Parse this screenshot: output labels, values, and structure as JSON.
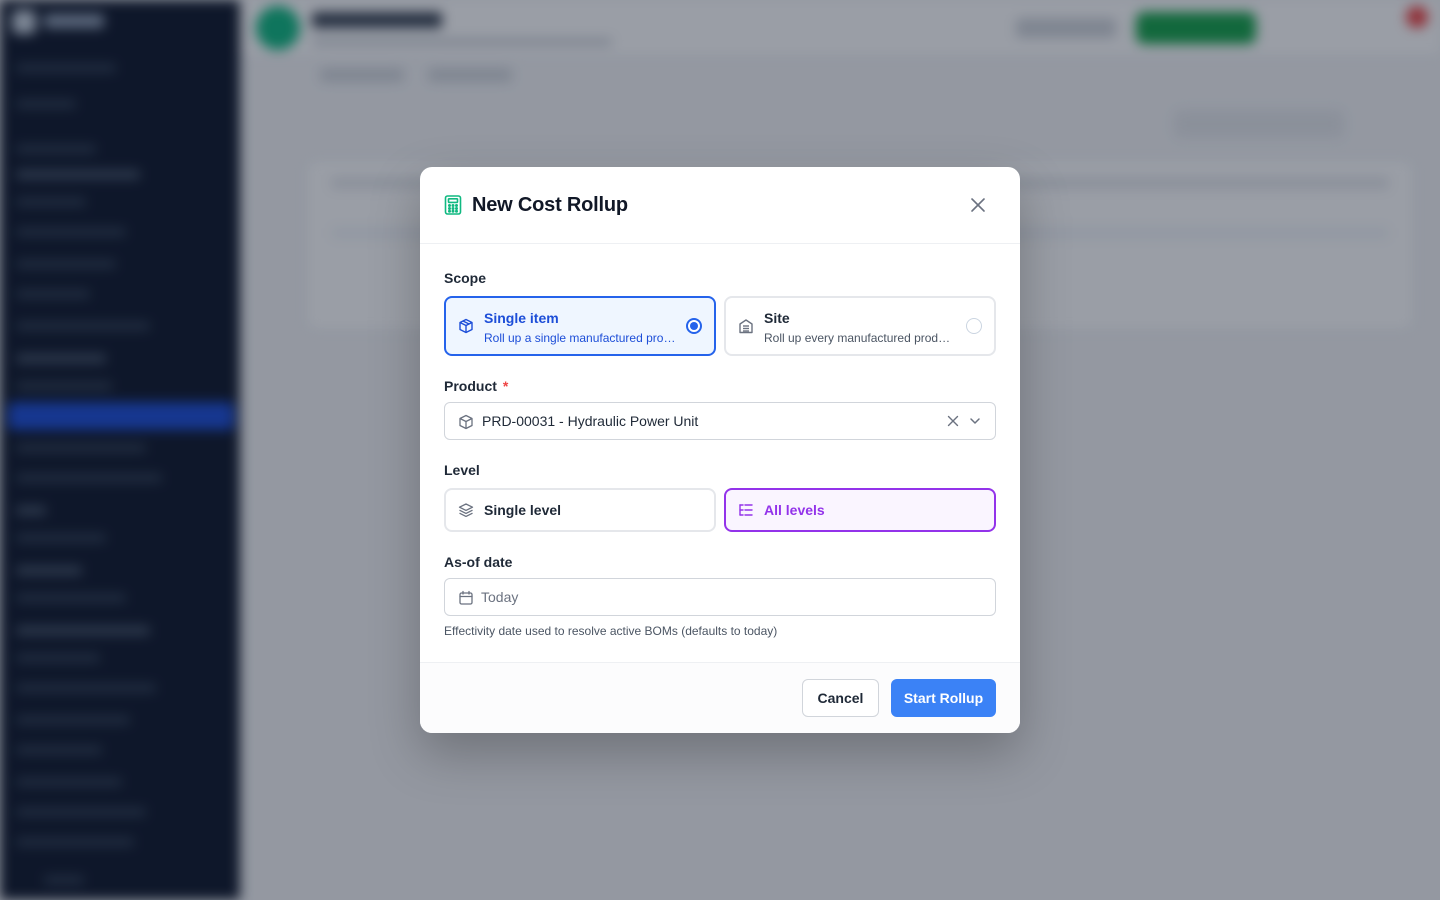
{
  "modal": {
    "title": "New Cost Rollup",
    "close_icon": "close-icon",
    "header_icon": "calculator-icon"
  },
  "scope": {
    "label": "Scope",
    "options": [
      {
        "title": "Single item",
        "description": "Roll up a single manufactured product",
        "icon": "package-icon",
        "selected": true
      },
      {
        "title": "Site",
        "description": "Roll up every manufactured product at a site",
        "icon": "building-icon",
        "selected": false
      }
    ]
  },
  "product": {
    "label": "Product",
    "required_marker": "*",
    "value": "PRD-00031 - Hydraulic Power Unit",
    "icon": "package-icon"
  },
  "level": {
    "label": "Level",
    "options": [
      {
        "label": "Single level",
        "icon": "layers-icon",
        "selected": false
      },
      {
        "label": "All levels",
        "icon": "tree-list-icon",
        "selected": true
      }
    ]
  },
  "as_of_date": {
    "label": "As-of date",
    "placeholder": "Today",
    "value": "",
    "icon": "calendar-icon",
    "help": "Effectivity date used to resolve active BOMs (defaults to today)"
  },
  "footer": {
    "cancel_label": "Cancel",
    "start_label": "Start Rollup"
  },
  "colors": {
    "primary": "#3b82f6",
    "scope_selected": "#2563eb",
    "level_selected": "#9333ea",
    "required": "#ef4444",
    "icon_accent": "#10b981"
  }
}
